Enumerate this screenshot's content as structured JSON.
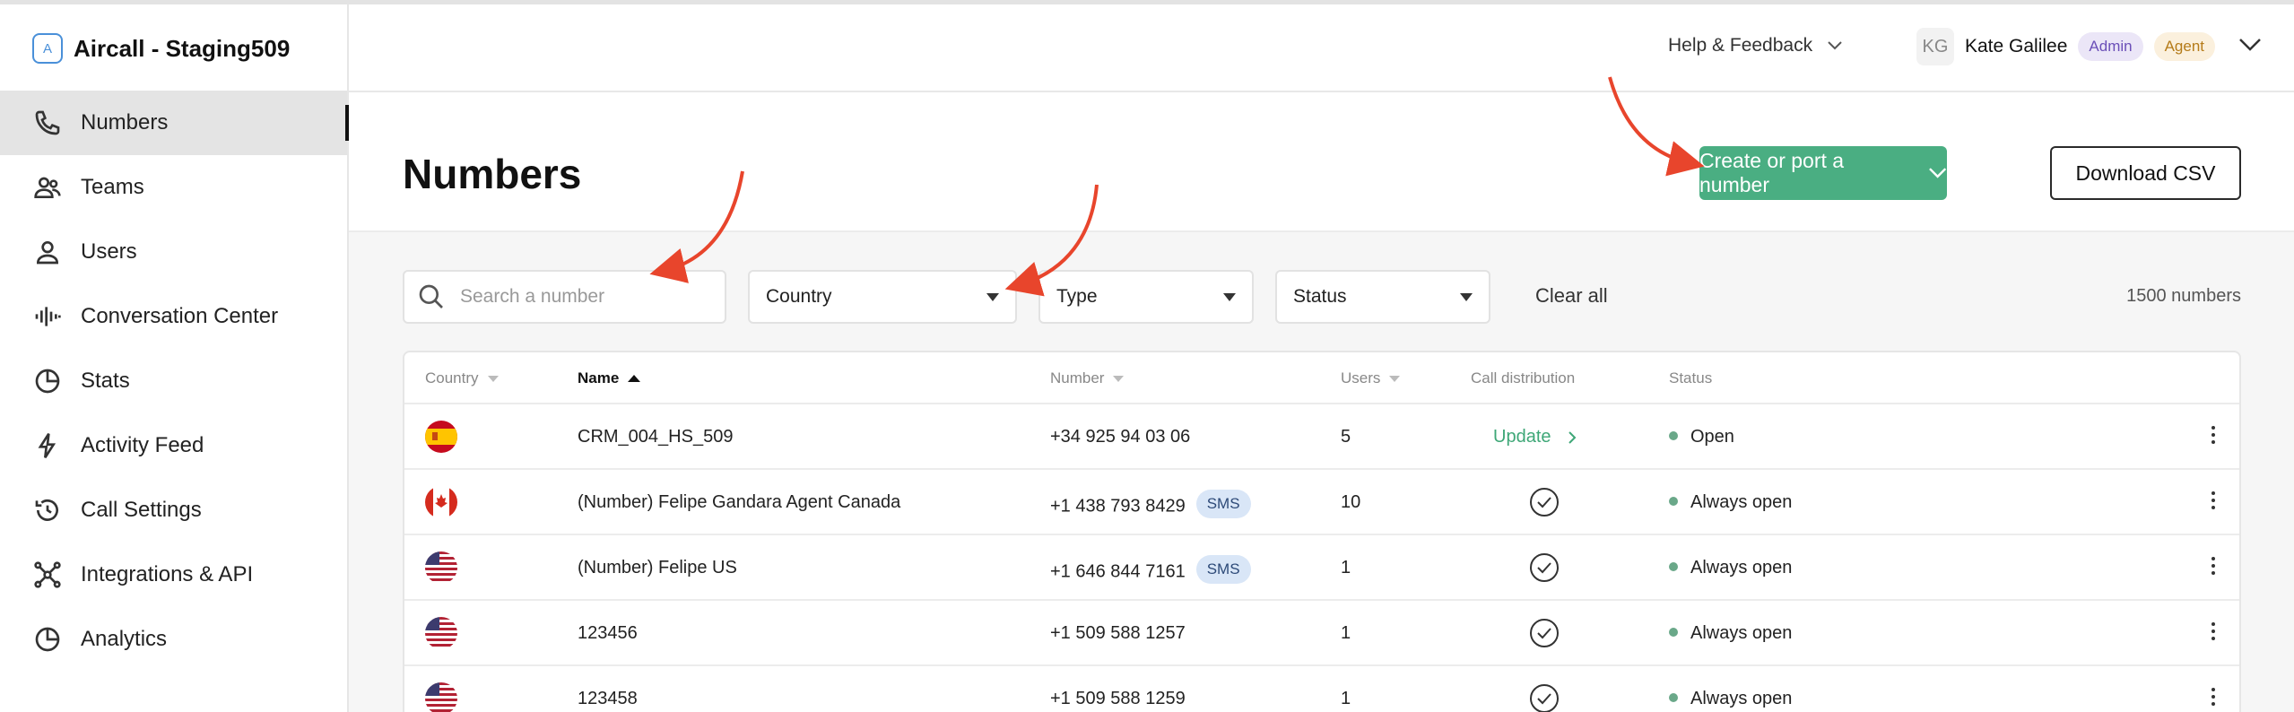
{
  "brand": {
    "logo_letter": "A",
    "name": "Aircall - Staging509"
  },
  "sidebar": {
    "items": [
      {
        "label": "Numbers",
        "icon": "phone-icon",
        "active": true
      },
      {
        "label": "Teams",
        "icon": "team-icon",
        "active": false
      },
      {
        "label": "Users",
        "icon": "user-icon",
        "active": false
      },
      {
        "label": "Conversation Center",
        "icon": "waveform-icon",
        "active": false
      },
      {
        "label": "Stats",
        "icon": "pie-chart-icon",
        "active": false
      },
      {
        "label": "Activity Feed",
        "icon": "lightning-icon",
        "active": false
      },
      {
        "label": "Call Settings",
        "icon": "history-icon",
        "active": false
      },
      {
        "label": "Integrations & API",
        "icon": "network-icon",
        "active": false
      },
      {
        "label": "Analytics",
        "icon": "pie-chart-icon",
        "active": false
      }
    ]
  },
  "header": {
    "help_label": "Help & Feedback",
    "user": {
      "initials": "KG",
      "name": "Kate Galilee",
      "badges": [
        "Admin",
        "Agent"
      ]
    }
  },
  "page": {
    "title": "Numbers",
    "primary_button": "Create or port a number",
    "secondary_button": "Download CSV"
  },
  "filters": {
    "search_placeholder": "Search a number",
    "country": "Country",
    "type": "Type",
    "status": "Status",
    "clear_all": "Clear all",
    "count": "1500 numbers"
  },
  "table": {
    "columns": [
      "Country",
      "Name",
      "Number",
      "Users",
      "Call distribution",
      "Status"
    ],
    "rows": [
      {
        "flag": "es",
        "name": "CRM_004_HS_509",
        "number": "+34 925 94 03 06",
        "sms": "",
        "users": "5",
        "distribution": "Update",
        "status": "Open"
      },
      {
        "flag": "ca",
        "name": "(Number) Felipe Gandara Agent Canada",
        "number": "+1 438 793 8429",
        "sms": "SMS",
        "users": "10",
        "distribution": "check",
        "status": "Always open"
      },
      {
        "flag": "us",
        "name": "(Number) Felipe US",
        "number": "+1 646 844 7161",
        "sms": "SMS",
        "users": "1",
        "distribution": "check",
        "status": "Always open"
      },
      {
        "flag": "us",
        "name": "123456",
        "number": "+1 509 588 1257",
        "sms": "",
        "users": "1",
        "distribution": "check",
        "status": "Always open"
      },
      {
        "flag": "us",
        "name": "123458",
        "number": "+1 509 588 1259",
        "sms": "",
        "users": "1",
        "distribution": "check",
        "status": "Always open"
      }
    ]
  },
  "colors": {
    "accent": "#4aae82",
    "annotation": "#e8452c",
    "active_nav": "#e4e4e4"
  }
}
